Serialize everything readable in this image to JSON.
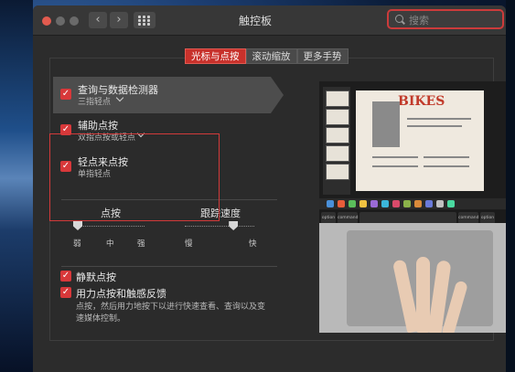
{
  "window": {
    "title": "触控板"
  },
  "search": {
    "placeholder": "搜索"
  },
  "nav": {
    "back": "‹",
    "forward": "›"
  },
  "tabs": [
    {
      "label": "光标与点按",
      "active": true
    },
    {
      "label": "滚动缩放",
      "active": false
    },
    {
      "label": "更多手势",
      "active": false
    }
  ],
  "options": [
    {
      "label": "查询与数据检测器",
      "sub": "三指轻点",
      "checked": true,
      "has_dropdown": true
    },
    {
      "label": "辅助点按",
      "sub": "双指点按或轻点",
      "checked": true,
      "has_dropdown": true
    },
    {
      "label": "轻点来点按",
      "sub": "单指轻点",
      "checked": true,
      "has_dropdown": false
    }
  ],
  "click_slider": {
    "title": "点按",
    "ticks": [
      "弱",
      "中",
      "强"
    ],
    "level": "弱"
  },
  "tracking_slider": {
    "title": "跟踪速度",
    "min_label": "慢",
    "max_label": "快",
    "value_fraction": 0.7
  },
  "bottom_options": [
    {
      "label": "静默点按",
      "checked": true
    },
    {
      "label": "用力点按和触感反馈",
      "checked": true,
      "sub1": "点按，然后用力地按下以进行快速查看、查询以及变",
      "sub2": "速媒体控制。"
    }
  ],
  "preview": {
    "doc_heading": "BIKES",
    "keys": [
      "option",
      "command",
      "command",
      "option"
    ]
  },
  "colors": {
    "accent": "#c8312b",
    "checkbox": "#d8383a",
    "window_bg": "#2c2c2c"
  }
}
